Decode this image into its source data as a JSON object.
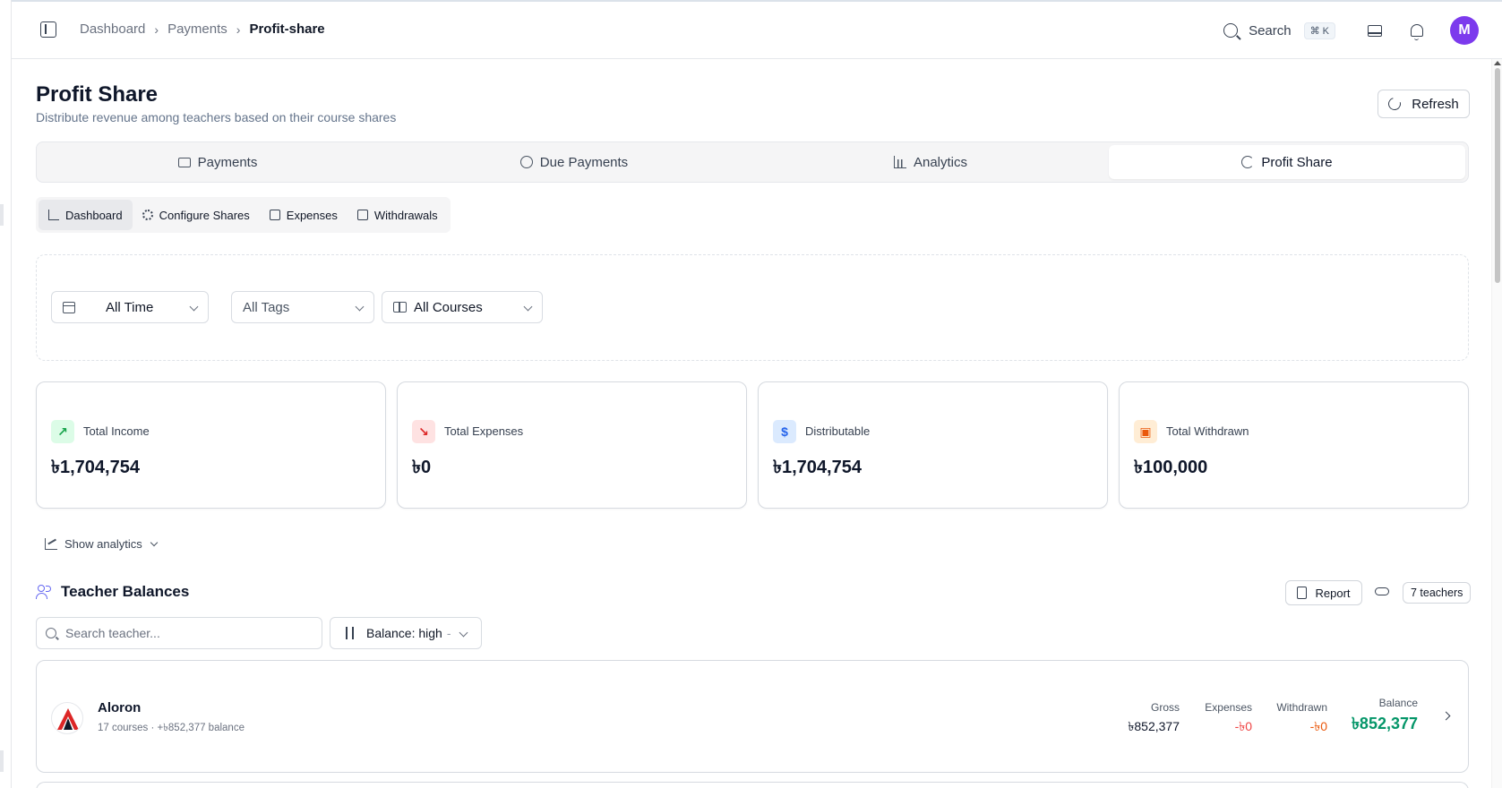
{
  "breadcrumb": {
    "items": [
      "Dashboard",
      "Payments"
    ],
    "current": "Profit-share"
  },
  "header": {
    "search_label": "Search",
    "shortcut": "⌘ K",
    "avatar_initial": "M"
  },
  "page": {
    "title": "Profit Share",
    "subtitle": "Distribute revenue among teachers based on their course shares",
    "refresh_label": "Refresh"
  },
  "tabs": [
    {
      "label": "Payments",
      "icon": "credit-card-icon"
    },
    {
      "label": "Due Payments",
      "icon": "clock-icon"
    },
    {
      "label": "Analytics",
      "icon": "bar-chart-icon"
    },
    {
      "label": "Profit Share",
      "icon": "pie-chart-icon",
      "active": true
    }
  ],
  "subtabs": [
    {
      "label": "Dashboard",
      "icon": "bar-chart-icon",
      "active": true
    },
    {
      "label": "Configure Shares",
      "icon": "gear-icon"
    },
    {
      "label": "Expenses",
      "icon": "receipt-icon"
    },
    {
      "label": "Withdrawals",
      "icon": "wallet-icon"
    }
  ],
  "filters": {
    "time": "All Time",
    "tags": "All Tags",
    "courses": "All Courses"
  },
  "stats": [
    {
      "label": "Total Income",
      "value": "৳1,704,754",
      "icon": "trending-up-icon",
      "color": "#16a34a"
    },
    {
      "label": "Total Expenses",
      "value": "৳0",
      "icon": "trending-down-icon",
      "color": "#dc2626"
    },
    {
      "label": "Distributable",
      "value": "৳1,704,754",
      "icon": "dollar-icon",
      "color": "#2563eb"
    },
    {
      "label": "Total Withdrawn",
      "value": "৳100,000",
      "icon": "wallet-icon",
      "color": "#ea580c"
    }
  ],
  "analytics_toggle": "Show analytics",
  "teacher_balances": {
    "title": "Teacher Balances",
    "report_label": "Report",
    "count": "7 teachers",
    "search_placeholder": "Search teacher...",
    "sort_label": "Balance: high",
    "sort_suffix": "-",
    "rows": [
      {
        "name": "Aloron",
        "meta": "17 courses · +৳852,377 balance",
        "gross_label": "Gross",
        "gross": "৳852,377",
        "expenses_label": "Expenses",
        "expenses": "-৳0",
        "withdrawn_label": "Withdrawn",
        "withdrawn": "-৳0",
        "balance_label": "Balance",
        "balance": "৳852,377"
      }
    ]
  },
  "colors": {
    "accent": "#7c3aed",
    "positive": "#059669",
    "negative": "#ef4444",
    "withdrawn": "#ea580c"
  }
}
